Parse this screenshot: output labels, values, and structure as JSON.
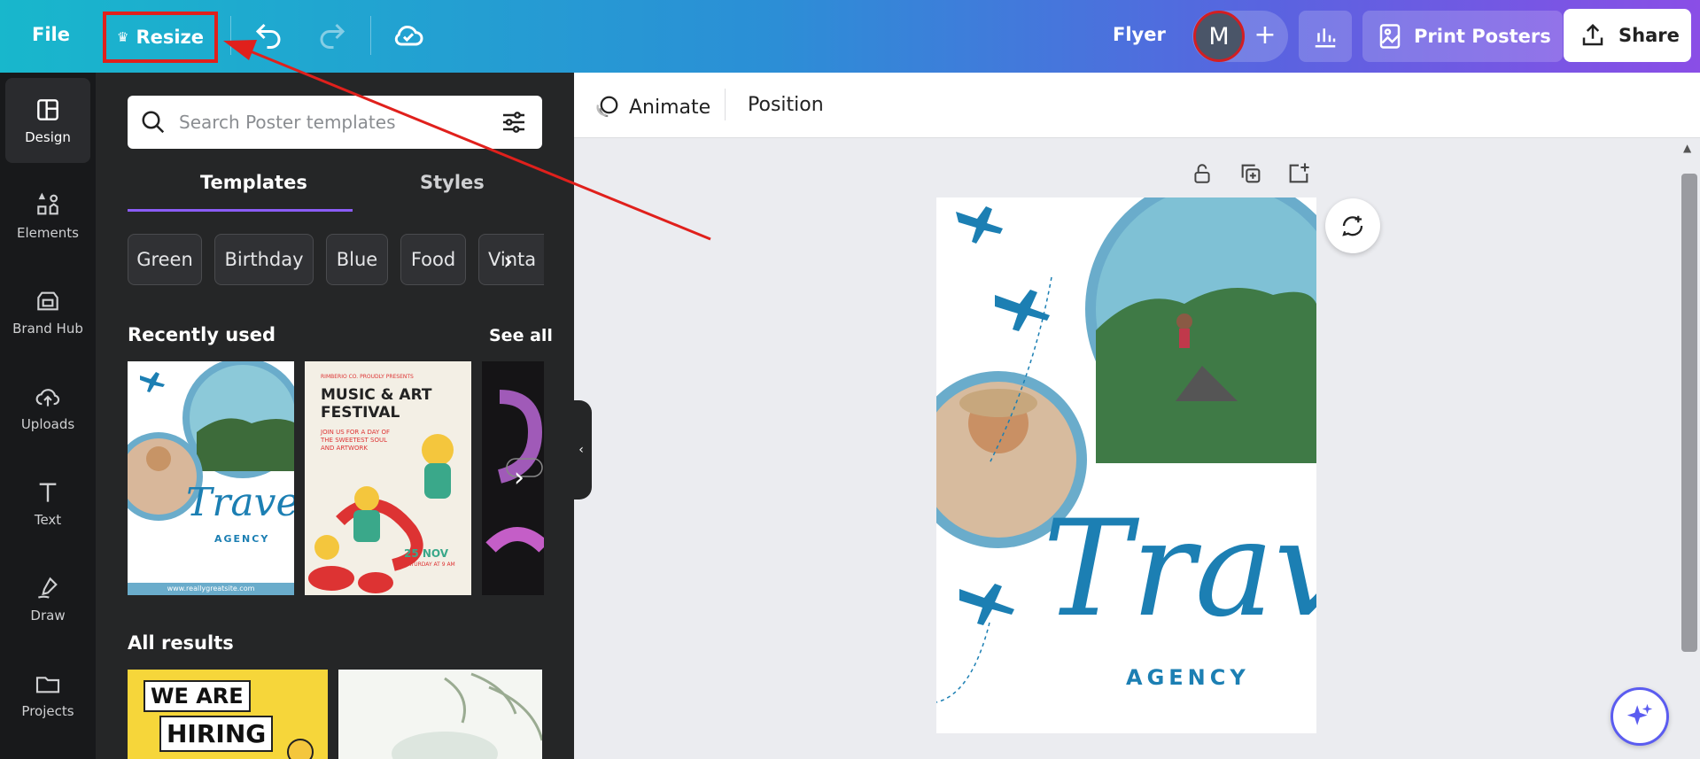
{
  "topbar": {
    "file_label": "File",
    "resize_label": "Resize",
    "doc_type": "Flyer",
    "avatar_initial": "M",
    "print_label": "Print Posters",
    "share_label": "Share"
  },
  "rail": {
    "items": [
      {
        "label": "Design",
        "icon": "layout-icon"
      },
      {
        "label": "Elements",
        "icon": "shapes-icon"
      },
      {
        "label": "Brand Hub",
        "icon": "brand-icon"
      },
      {
        "label": "Uploads",
        "icon": "cloud-upload-icon"
      },
      {
        "label": "Text",
        "icon": "text-icon"
      },
      {
        "label": "Draw",
        "icon": "pen-icon"
      },
      {
        "label": "Projects",
        "icon": "folder-icon"
      }
    ]
  },
  "panel": {
    "search_placeholder": "Search Poster templates",
    "tabs": [
      "Templates",
      "Styles"
    ],
    "chips": [
      "Green",
      "Birthday",
      "Blue",
      "Food",
      "Vinta"
    ],
    "recently_used_title": "Recently used",
    "see_all_label": "See all",
    "all_results_title": "All results",
    "thumb1": {
      "title": "Travel",
      "subtitle": "AGENCY",
      "url": "www.reallygreatsite.com"
    },
    "thumb2": {
      "kicker": "RIMBERIO CO. PROUDLY PRESENTS",
      "title_line1": "MUSIC & ART",
      "title_line2": "FESTIVAL",
      "sub": "JOIN US FOR A DAY OF THE SWEETEST SOUL AND ARTWORK",
      "date": "25 NOV",
      "date_sub": "SATURDAY AT 9 AM"
    },
    "result1": {
      "line1": "WE ARE",
      "line2": "HIRING"
    }
  },
  "context_bar": {
    "animate_label": "Animate",
    "position_label": "Position"
  },
  "poster": {
    "title": "Travel",
    "subtitle": "AGENCY"
  },
  "colors": {
    "accent_purple": "#8b5cf6",
    "poster_blue": "#1c7fb3",
    "annotation_red": "#e0201c"
  }
}
